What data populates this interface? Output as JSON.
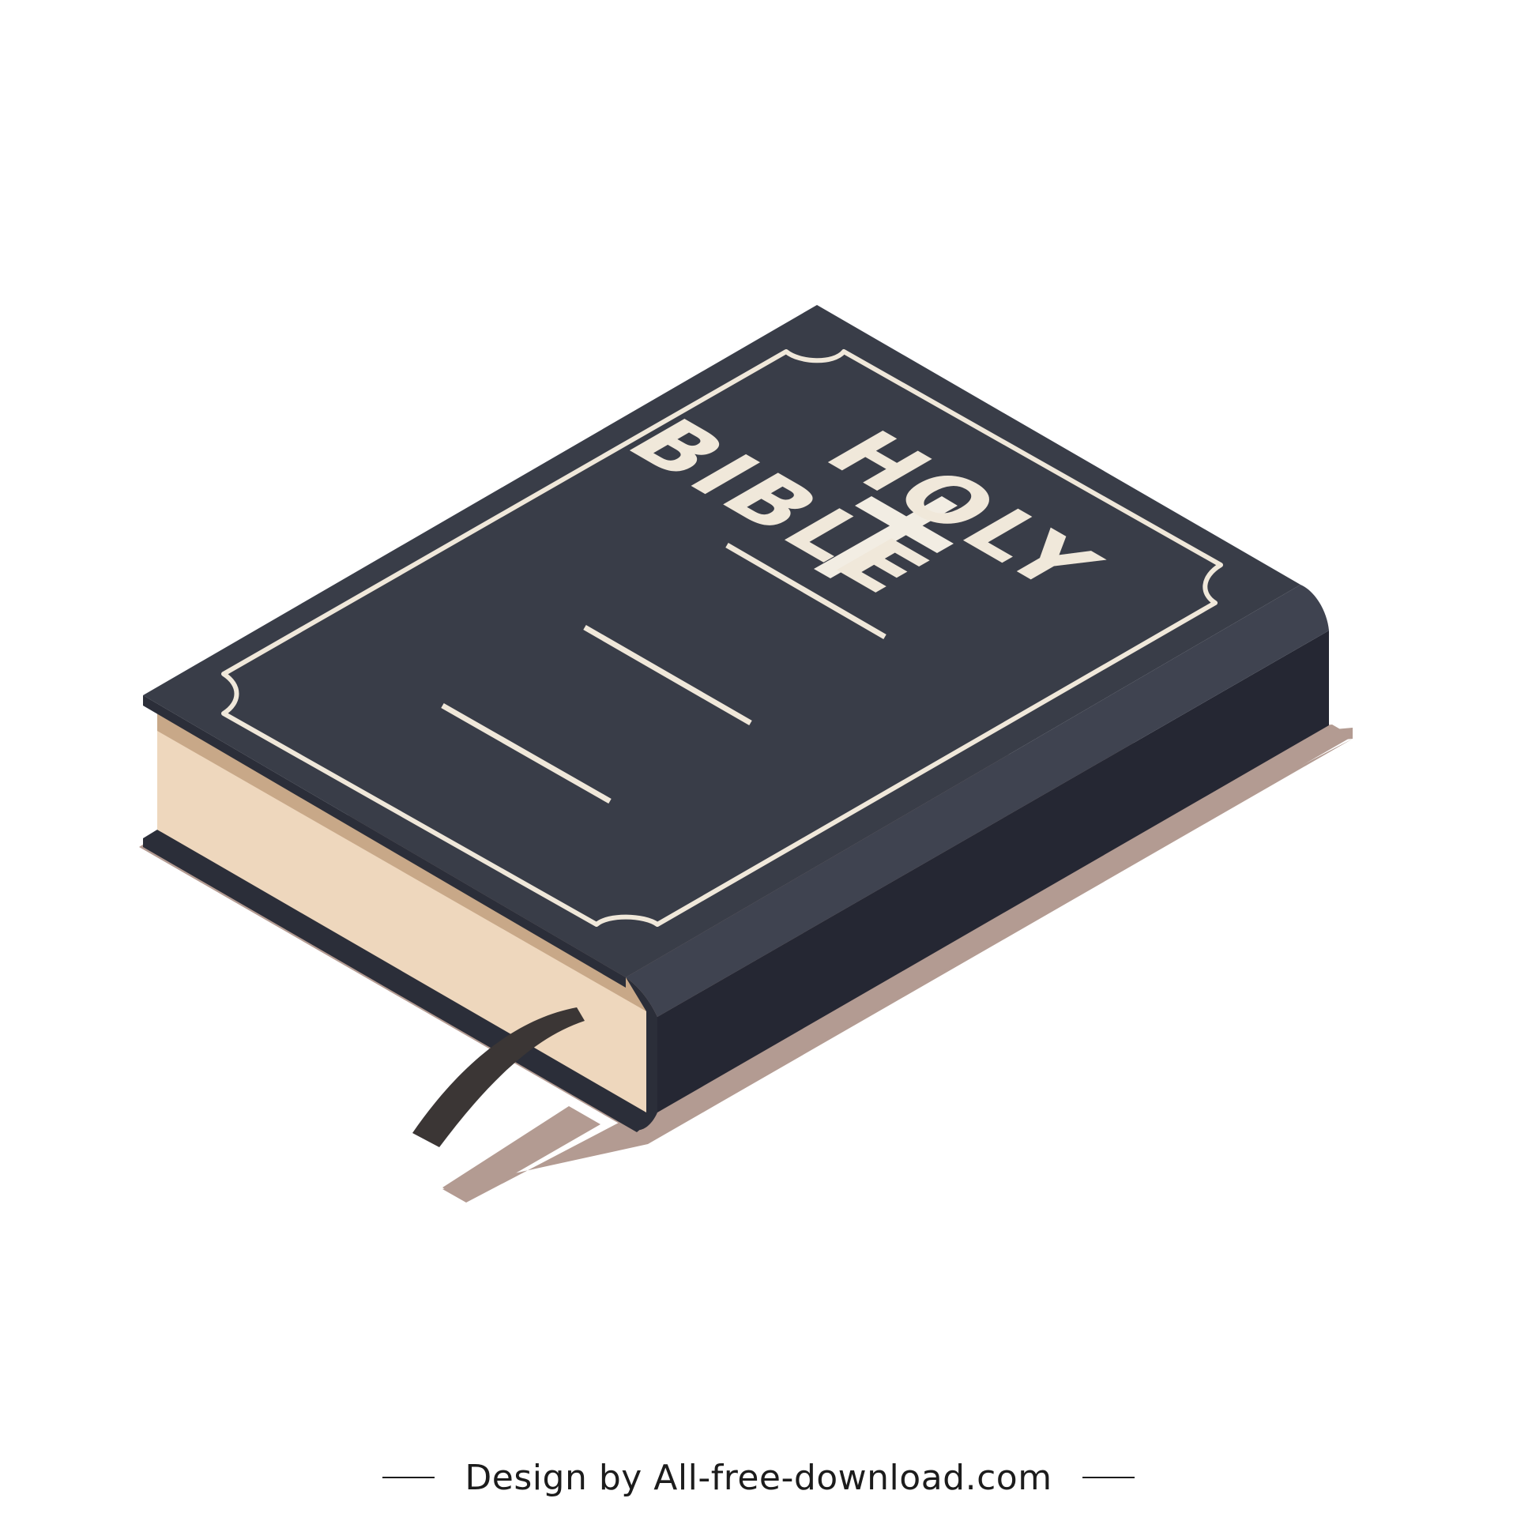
{
  "illustration": {
    "subject": "holy-bible-book",
    "cover_title_line1": "HOLY",
    "cover_title_line2": "BIBLE",
    "icons": [
      "cross-icon",
      "bookmark-ribbon"
    ],
    "colors": {
      "cover_top": "#393d48",
      "cover_spine": "#252733",
      "cover_edge": "#2b2e39",
      "cover_edge_top": "#444855",
      "pages": "#eed7bd",
      "pages_shade": "#c8a888",
      "ornament": "#f0e8da",
      "cross": "#f2ede3",
      "ribbon": "#3b3635",
      "shadow": "#b39b92",
      "background": "#ffffff"
    }
  },
  "footer": {
    "credit": "Design by All-free-download.com"
  }
}
